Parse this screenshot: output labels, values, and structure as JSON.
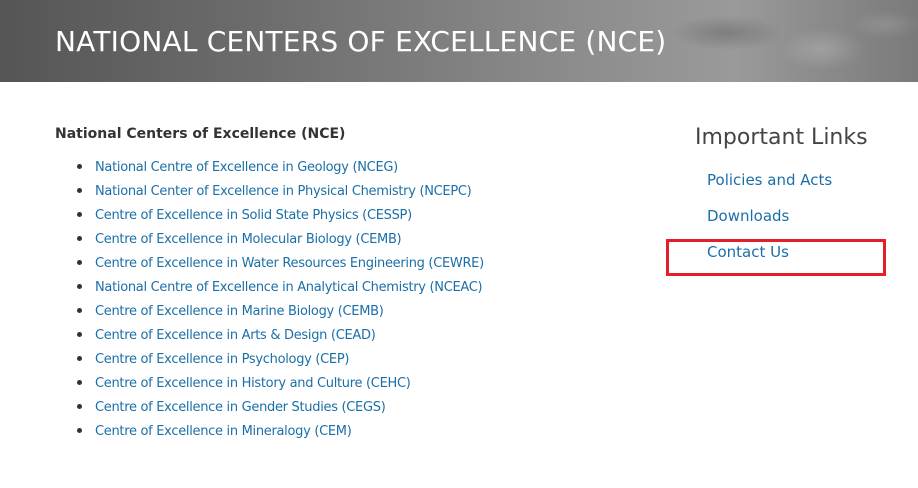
{
  "banner": {
    "title": "NATIONAL CENTERS OF EXCELLENCE (NCE)"
  },
  "main": {
    "heading": "National Centers of Excellence (NCE)",
    "items": [
      "National Centre of Excellence in Geology (NCEG)",
      "National Center of Excellence in Physical Chemistry (NCEPC)",
      "Centre of Excellence in Solid State Physics (CESSP)",
      "Centre of Excellence in Molecular Biology (CEMB)",
      "Centre of Excellence in Water Resources Engineering (CEWRE)",
      "National Centre of Excellence in Analytical Chemistry (NCEAC)",
      "Centre of Excellence in Marine Biology (CEMB)",
      "Centre of Excellence in Arts & Design (CEAD)",
      "Centre of Excellence in Psychology (CEP)",
      "Centre of Excellence in History and Culture (CEHC)",
      "Centre of Excellence in Gender Studies (CEGS)",
      "Centre of Excellence in Mineralogy (CEM)"
    ]
  },
  "sidebar": {
    "title": "Important Links",
    "links": [
      "Policies and Acts",
      "Downloads",
      "Contact Us"
    ]
  },
  "colors": {
    "link": "#1b6fa8",
    "highlight": "#e3202a",
    "banner_text": "#ffffff"
  }
}
